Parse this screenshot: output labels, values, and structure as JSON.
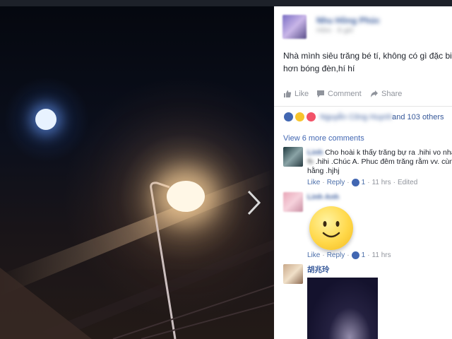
{
  "post": {
    "author": "Nhu Hồng Phúc",
    "meta": "Hôm · 8 giờ",
    "text_line1": "Nhà mình siêu trăng bé tí, không có gì đặc biệt",
    "text_line2": "hơn bóng đèn,hí hí"
  },
  "actions": {
    "like": "Like",
    "comment": "Comment",
    "share": "Share"
  },
  "reactions": {
    "names": "Nguyễn Công Huynh",
    "others": " and 103 others"
  },
  "comments": {
    "view_more": "View 6 more comments",
    "c1": {
      "name": "Linh",
      "line1": "Cho hoài k thấy trăng bự ra .hihi vo nhà",
      "line2_prefix": "fb",
      "line2": ".hihi .Chúc A. Phuc đêm trăng rằm vv. cùng chị",
      "line3": "hằng .hjhj",
      "like": "Like",
      "reply": "Reply",
      "count": "1",
      "time": "11 hrs",
      "edited": "Edited"
    },
    "c2": {
      "name": "Linh Anh",
      "like": "Like",
      "reply": "Reply",
      "count": "1",
      "time": "11 hrs"
    },
    "c3": {
      "name": "胡兆玲"
    }
  },
  "colors": {
    "link": "#365899",
    "like_blue": "#4267b2",
    "love_red": "#f25268",
    "haha_yellow": "#f7c42c"
  }
}
